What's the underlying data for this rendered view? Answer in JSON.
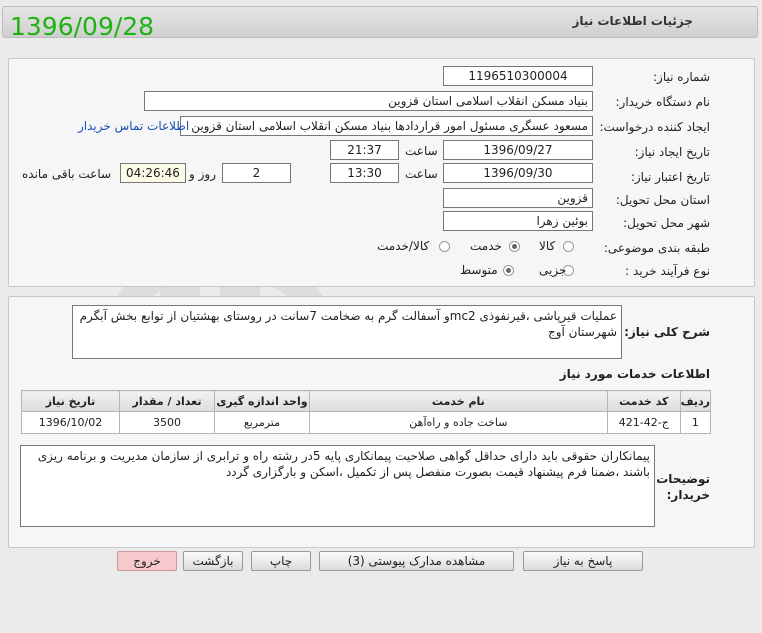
{
  "header": {
    "title": "جزئیات اطلاعات نیاز",
    "date_stamp": "1396/09/28"
  },
  "form": {
    "need_number_label": "شماره نیاز:",
    "need_number": "1196510300004",
    "buyer_org_label": "نام دستگاه خریدار:",
    "buyer_org": "بنیاد مسکن انقلاب اسلامی استان قزوین",
    "requester_label": "ایجاد کننده درخواست:",
    "requester": "مسعود عسگری مسئول امور قراردادها بنیاد مسکن انقلاب اسلامی استان قزوین",
    "buyer_contact_link": "اطلاعات تماس خریدار",
    "created_label": "تاریخ ایجاد نیاز:",
    "created_date": "1396/09/27",
    "time_label": "ساعت",
    "created_time": "21:37",
    "valid_label": "تاریخ اعتبار نیاز:",
    "valid_date": "1396/09/30",
    "valid_time": "13:30",
    "days_value": "2",
    "days_label": "روز و",
    "remaining_time": "04:26:46",
    "remaining_label": "ساعت باقی مانده",
    "province_label": "استان محل تحویل:",
    "province": "قزوین",
    "city_label": "شهر محل تحویل:",
    "city": "بوئین زهرا",
    "category_label": "طبقه بندی موضوعی:",
    "category_options": [
      "کالا",
      "خدمت",
      "کالا/خدمت"
    ],
    "category_selected": "خدمت",
    "process_label": "نوع فرآیند خرید :",
    "process_options": [
      "جزیی",
      "متوسط"
    ],
    "process_selected": "متوسط"
  },
  "description": {
    "label": "شرح کلی نیاز:",
    "text": "عملیات قیرپاشی ،قیرنفوذی mc2و آسفالت گرم به ضخامت 7سانت در روستای بهشتیان از توابع بخش آبگرم شهرستان آوج"
  },
  "services": {
    "title": "اطلاعات خدمات مورد نیاز",
    "columns": [
      "ردیف",
      "کد خدمت",
      "نام خدمت",
      "واحد اندازه گیری",
      "تعداد / مقدار",
      "تاریخ نیاز"
    ],
    "rows": [
      [
        "1",
        "ج-42-421",
        "ساخت جاده و راه‌آهن",
        "مترمربع",
        "3500",
        "1396/10/02"
      ]
    ]
  },
  "buyer_notes": {
    "label_line1": "توضیحات",
    "label_line2": "خریدار:",
    "text": "پیمانکاران حقوقی باید  دارای حداقل گواهی صلاحیت پیمانکاری پایه 5در رشته راه و ترابری از سازمان مدیریت و برنامه ریزی باشند ،ضمنا فرم پیشنهاد قیمت بصورت منفصل پس از تکمیل ،اسکن و بارگزاری گردد"
  },
  "buttons": {
    "reply": "پاسخ به نیاز",
    "attachments": "مشاهده مدارک پیوستی (3)",
    "print": "چاپ",
    "back": "بازگشت",
    "exit": "خروج"
  },
  "colors": {
    "date_stamp": "#1db312",
    "link": "#1a4fb5",
    "exit_button": "#f7c9cc"
  }
}
